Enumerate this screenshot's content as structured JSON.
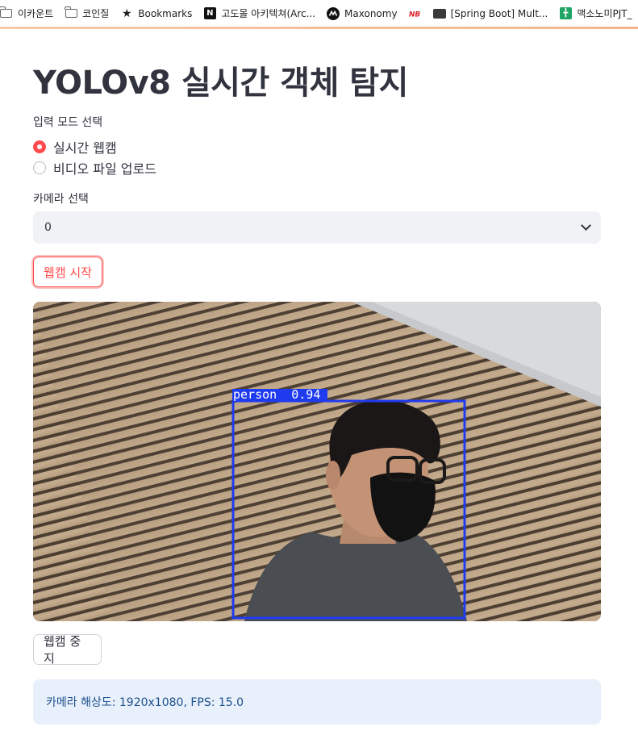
{
  "bookmarks": [
    {
      "icon": "folder-icon",
      "label": "이카운트"
    },
    {
      "icon": "folder-icon",
      "label": "코인질"
    },
    {
      "icon": "star-icon",
      "label": "Bookmarks"
    },
    {
      "icon": "notion-icon",
      "label": "고도몰 아키텍쳐(Arc..."
    },
    {
      "icon": "maxonomy-icon",
      "label": "Maxonomy"
    },
    {
      "icon": "newbalance-icon",
      "label": ""
    },
    {
      "icon": "page-icon",
      "label": "[Spring Boot] Mult..."
    },
    {
      "icon": "sheet-icon",
      "label": "맥소노미PJT_"
    }
  ],
  "app": {
    "title": "YOLOv8 실시간 객체 탐지",
    "mode_label": "입력 모드 선택",
    "mode_options": [
      "실시간 웹캠",
      "비디오 파일 업로드"
    ],
    "mode_selected": "실시간 웹캠",
    "camera_label": "카메라 선택",
    "camera_value": "0",
    "start_button": "웹캠 시작",
    "stop_button": "웹캠 중지",
    "detection_label": "person  0.94",
    "status_text": "카메라 해상도: 1920x1080, FPS: 15.0"
  },
  "colors": {
    "accent": "#ff4b4b",
    "detection_box": "#1f3bf0",
    "info_bg": "#e8f0fb",
    "info_text": "#1c4f8c"
  }
}
